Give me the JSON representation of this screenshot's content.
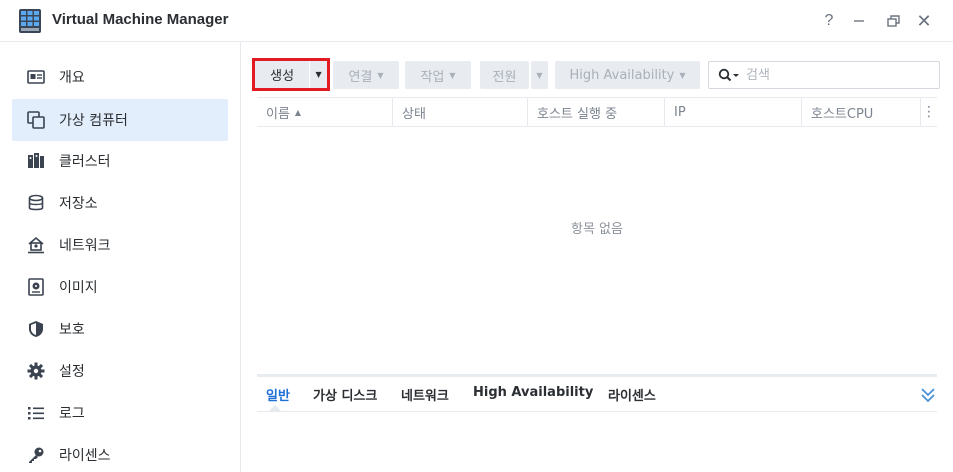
{
  "window": {
    "title": "Virtual Machine Manager",
    "controls": {
      "help": "?",
      "close": "✕"
    }
  },
  "sidebar": {
    "items": [
      {
        "id": "overview",
        "label": "개요",
        "icon": "dashboard-card-icon",
        "active": false
      },
      {
        "id": "guests",
        "label": "가상 컴퓨터",
        "icon": "copy-windows-icon",
        "active": true
      },
      {
        "id": "cluster",
        "label": "클러스터",
        "icon": "server-rack-icon",
        "active": false
      },
      {
        "id": "storage",
        "label": "저장소",
        "icon": "database-icon",
        "active": false
      },
      {
        "id": "network",
        "label": "네트워크",
        "icon": "network-house-icon",
        "active": false
      },
      {
        "id": "image",
        "label": "이미지",
        "icon": "disc-image-icon",
        "active": false
      },
      {
        "id": "protection",
        "label": "보호",
        "icon": "shield-icon",
        "active": false
      },
      {
        "id": "settings",
        "label": "설정",
        "icon": "gear-icon",
        "active": false
      },
      {
        "id": "log",
        "label": "로그",
        "icon": "list-icon",
        "active": false
      },
      {
        "id": "license",
        "label": "라이센스",
        "icon": "key-icon",
        "active": false
      }
    ]
  },
  "toolbar": {
    "create": "생성",
    "connect": "연결",
    "action": "작업",
    "power": "전원",
    "high_availability": "High Availability",
    "search_placeholder": "검색"
  },
  "table": {
    "columns": [
      "이름",
      "상태",
      "호스트 실행 중",
      "IP",
      "호스트CPU"
    ],
    "sort_indicator": "▲",
    "empty_text": "항목 없음"
  },
  "details": {
    "tabs": [
      "일반",
      "가상 디스크",
      "네트워크",
      "High Availability",
      "라이센스"
    ],
    "active_tab": "일반"
  },
  "colors": {
    "accent": "#1e6fd6",
    "highlight_border": "#e21b23",
    "active_nav_bg": "#e3eefc"
  }
}
